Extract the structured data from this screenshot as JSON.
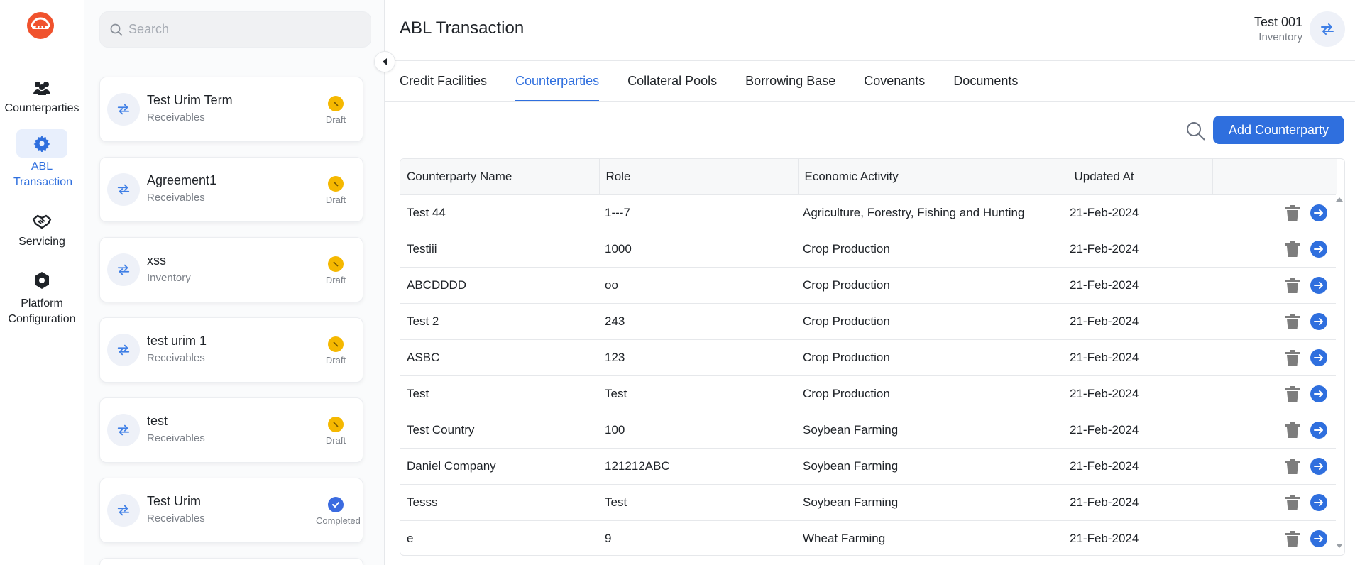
{
  "nav": {
    "items": [
      {
        "label": "Counterparties",
        "icon": "people-group-icon",
        "active": false
      },
      {
        "label": "ABL Transaction",
        "icon": "gear-icon",
        "active": true
      },
      {
        "label": "Servicing",
        "icon": "handshake-icon",
        "active": false
      },
      {
        "label": "Platform Configuration",
        "icon": "hexagon-icon",
        "active": false
      }
    ]
  },
  "search": {
    "placeholder": "Search"
  },
  "list": {
    "cards": [
      {
        "title": "Test Urim Term",
        "subtitle": "Receivables",
        "status": "Draft"
      },
      {
        "title": "Agreement1",
        "subtitle": "Receivables",
        "status": "Draft"
      },
      {
        "title": "xss",
        "subtitle": "Inventory",
        "status": "Draft"
      },
      {
        "title": "test urim 1",
        "subtitle": "Receivables",
        "status": "Draft"
      },
      {
        "title": "test",
        "subtitle": "Receivables",
        "status": "Draft"
      },
      {
        "title": "Test Urim",
        "subtitle": "Receivables",
        "status": "Completed"
      }
    ]
  },
  "header": {
    "title": "ABL Transaction",
    "user_name": "Test 001",
    "user_role": "Inventory"
  },
  "tabs": [
    {
      "label": "Credit Facilities",
      "active": false
    },
    {
      "label": "Counterparties",
      "active": true
    },
    {
      "label": "Collateral Pools",
      "active": false
    },
    {
      "label": "Borrowing Base",
      "active": false
    },
    {
      "label": "Covenants",
      "active": false
    },
    {
      "label": "Documents",
      "active": false
    }
  ],
  "toolbar": {
    "add_label": "Add Counterparty"
  },
  "table": {
    "headers": [
      "Counterparty Name",
      "Role",
      "Economic Activity",
      "Updated At"
    ],
    "rows": [
      [
        "Test 44",
        "1---7",
        "Agriculture, Forestry, Fishing and Hunting",
        "21-Feb-2024"
      ],
      [
        "Testiii",
        "1000",
        "Crop Production",
        "21-Feb-2024"
      ],
      [
        "ABCDDDD",
        "oo",
        "Crop Production",
        "21-Feb-2024"
      ],
      [
        "Test 2",
        "243",
        "Crop Production",
        "21-Feb-2024"
      ],
      [
        "ASBC",
        "123",
        "Crop Production",
        "21-Feb-2024"
      ],
      [
        "Test",
        "Test",
        "Crop Production",
        "21-Feb-2024"
      ],
      [
        "Test Country",
        "100",
        "Soybean Farming",
        "21-Feb-2024"
      ],
      [
        "Daniel Company",
        "121212ABC",
        "Soybean Farming",
        "21-Feb-2024"
      ],
      [
        "Tesss",
        "Test",
        "Soybean Farming",
        "21-Feb-2024"
      ],
      [
        "e",
        "9",
        "Wheat Farming",
        "21-Feb-2024"
      ]
    ]
  },
  "colors": {
    "accent": "#2f6fde",
    "draft": "#f5b800",
    "completed": "#3b6be0",
    "logo": "#f0522d"
  }
}
